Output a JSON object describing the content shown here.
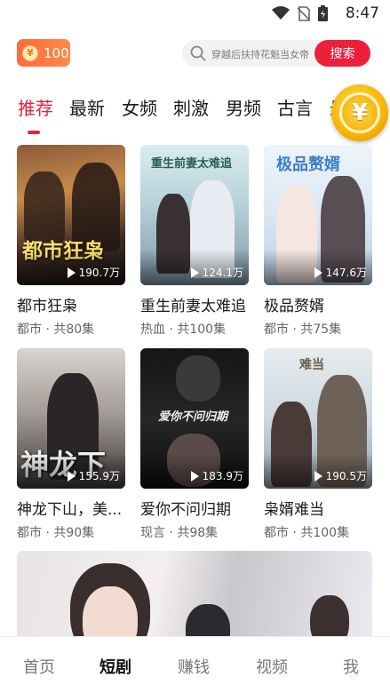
{
  "status_bar": {
    "time": "8:47"
  },
  "header": {
    "coin_icon_char": "¥",
    "coin_count": "100",
    "search_placeholder": "穿越后扶持花魁当女帝",
    "search_button": "搜索"
  },
  "tabs": [
    {
      "label": "推荐"
    },
    {
      "label": "最新"
    },
    {
      "label": "女频"
    },
    {
      "label": "刺激"
    },
    {
      "label": "男频"
    },
    {
      "label": "古言"
    },
    {
      "label": "最"
    }
  ],
  "float_coin_char": "¥",
  "dramas": [
    {
      "title": "都市狂枭",
      "meta": "都市 · 共80集",
      "views": "190.7万",
      "poster_text": "都市狂枭"
    },
    {
      "title": "重生前妻太难追",
      "meta": "热血 · 共100集",
      "views": "124.1万",
      "poster_text": "重生前妻太难追"
    },
    {
      "title": "极品赘婿",
      "meta": "都市 · 共75集",
      "views": "147.6万",
      "poster_text": "极品赘婿"
    },
    {
      "title": "神龙下山，美...",
      "meta": "都市 · 共90集",
      "views": "155.9万",
      "poster_text": "神龙下"
    },
    {
      "title": "爱你不问归期",
      "meta": "现言 · 共98集",
      "views": "183.9万",
      "poster_text": "爱你不问归期"
    },
    {
      "title": "枭婿难当",
      "meta": "都市 · 共100集",
      "views": "190.5万",
      "poster_text": "难当"
    }
  ],
  "bottom_nav": [
    {
      "label": "首页"
    },
    {
      "label": "短剧"
    },
    {
      "label": "赚钱"
    },
    {
      "label": "视频"
    },
    {
      "label": "我"
    }
  ]
}
